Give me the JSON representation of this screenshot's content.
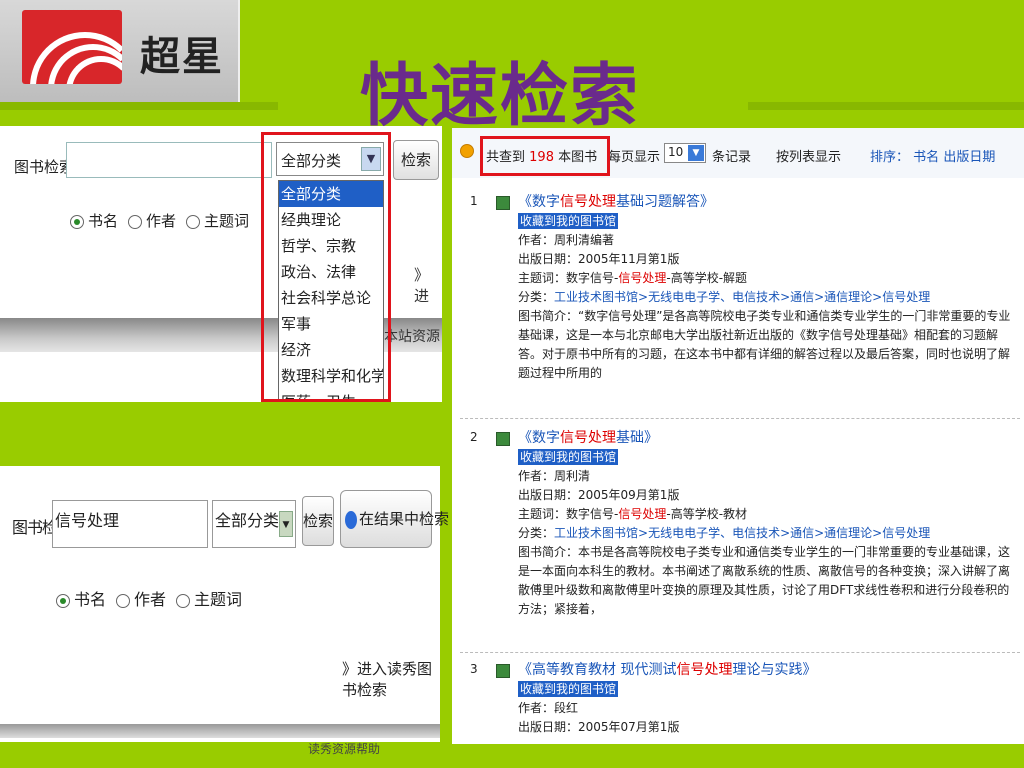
{
  "header": {
    "logo_text": "超星",
    "title": "快速检索"
  },
  "panel1": {
    "label": "图书检索",
    "category_selected": "全部分类",
    "search_button": "检索",
    "radios": [
      "书名",
      "作者",
      "主题词"
    ],
    "goto_link": "》进",
    "bar_text": "本站资源",
    "dropdown_options": [
      "全部分类",
      "经典理论",
      "哲学、宗教",
      "政治、法律",
      "社会科学总论",
      "军事",
      "经济",
      "数理科学和化学",
      "医药、卫生"
    ]
  },
  "panel2": {
    "label": "图书检索",
    "query_value": "信号处理",
    "category_selected": "全部分类",
    "search_button": "检索",
    "search_in_results_button": "在结果中检索",
    "radios": [
      "书名",
      "作者",
      "主题词"
    ],
    "goto_link": "》进入读秀图书检索",
    "bottom_text": "读秀资源帮助"
  },
  "results": {
    "found_prefix": "共查到",
    "found_count": "198",
    "found_suffix": "本图书",
    "per_page_label": "每页显示",
    "per_page_value": "10",
    "records_label": "条记录",
    "list_view": "按列表显示",
    "sort_label": "排序：",
    "sort_name": "书名",
    "sort_date": "出版日期",
    "entries": [
      {
        "num": "1",
        "title_pre": "《数字",
        "title_hl": "信号处理",
        "title_post": "基础习题解答》",
        "fav": "收藏到我的图书馆",
        "author": "作者：周利清编著",
        "date": "出版日期：2005年11月第1版",
        "subject_pre": "主题词：数字信号-",
        "subject_hl": "信号处理",
        "subject_post": "-高等学校-解题",
        "cat_label": "分类：",
        "category": "工业技术图书馆>无线电电子学、电信技术>通信>通信理论>信号处理",
        "summary": "图书简介：“数字信号处理”是各高等院校电子类专业和通信类专业学生的一门非常重要的专业基础课，这是一本与北京邮电大学出版社新近出版的《数字信号处理基础》相配套的习题解答。对于原书中所有的习题，在这本书中都有详细的解答过程以及最后答案，同时也说明了解题过程中所用的"
      },
      {
        "num": "2",
        "title_pre": "《数字",
        "title_hl": "信号处理",
        "title_post": "基础》",
        "fav": "收藏到我的图书馆",
        "author": "作者：周利清",
        "date": "出版日期：2005年09月第1版",
        "subject_pre": "主题词：数字信号-",
        "subject_hl": "信号处理",
        "subject_post": "-高等学校-教材",
        "cat_label": "分类：",
        "category": "工业技术图书馆>无线电电子学、电信技术>通信>通信理论>信号处理",
        "summary": "图书简介：本书是各高等院校电子类专业和通信类专业学生的一门非常重要的专业基础课，这是一本面向本科生的教材。本书阐述了离散系统的性质、离散信号的各种变换；深入讲解了离散傅里叶级数和离散傅里叶变换的原理及其性质，讨论了用DFT求线性卷积和进行分段卷积的方法；紧接着，"
      },
      {
        "num": "3",
        "title_pre": "《高等教育教材 现代测试",
        "title_hl": "信号处理",
        "title_post": "理论与实践》",
        "fav": "收藏到我的图书馆",
        "author": "作者：段红",
        "date": "出版日期：2005年07月第1版"
      }
    ]
  }
}
